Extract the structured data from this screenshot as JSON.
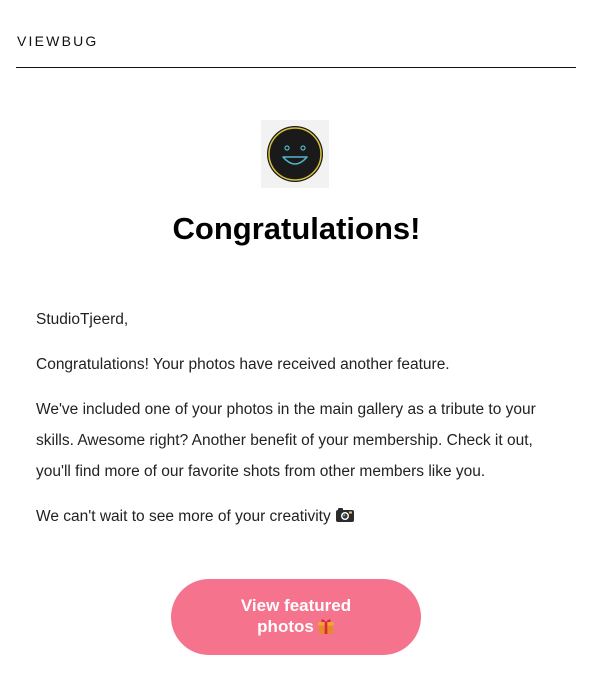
{
  "header": {
    "brand": "VIEWBUG"
  },
  "hero": {
    "icon": "smiley-face-icon",
    "title": "Congratulations!"
  },
  "message": {
    "greeting": "StudioTjeerd,",
    "paragraph1": "Congratulations! Your photos have received another feature.",
    "paragraph2": "We've included one of your photos in the main gallery as a tribute to your skills. Awesome right? Another benefit of your membership. Check it out, you'll find more of our favorite shots from other members like you.",
    "closing": "We can't wait to see more of your creativity",
    "closing_icon": "camera-icon"
  },
  "cta": {
    "label": "View featured photos",
    "icon": "gift-icon",
    "color": "#f6738d"
  }
}
